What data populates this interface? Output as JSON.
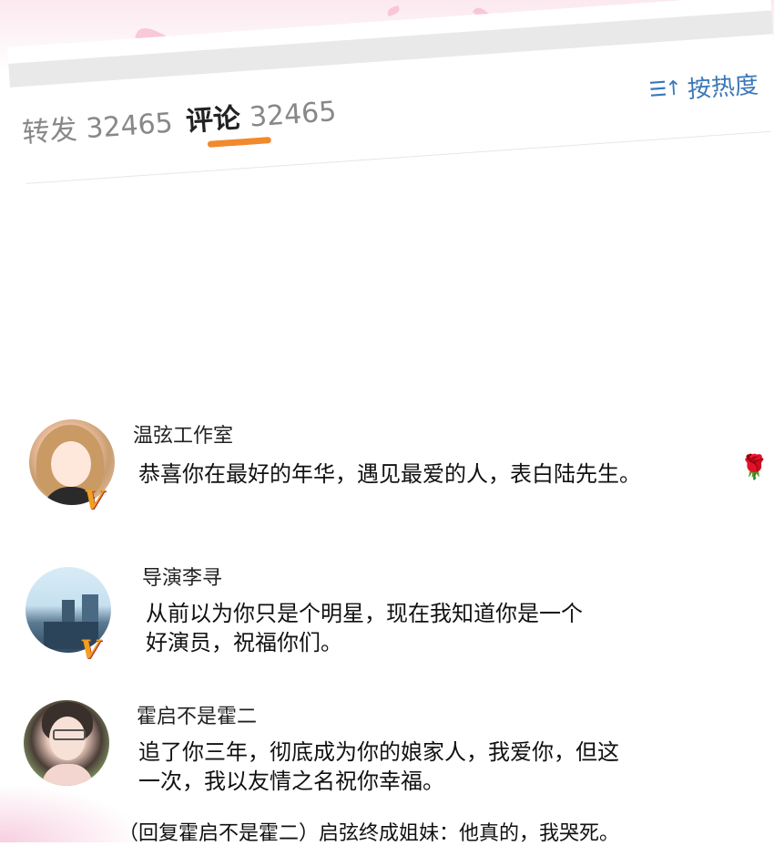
{
  "tabs": {
    "repost_label": "转发",
    "repost_count": "32465",
    "comments_label": "评论",
    "comments_count": "32465",
    "sort_label": "按热度",
    "sort_icon": "sort-descending-icon",
    "active_color": "#f08a2c",
    "sort_color": "#3b78b8"
  },
  "comments": [
    {
      "username": "温弦工作室",
      "text": "恭喜你在最好的年华，遇见最爱的人，表白陆先生。",
      "emoji": "🌹",
      "verified": "V"
    },
    {
      "username": "导演李寻",
      "text_line1": "从前以为你只是个明星，现在我知道你是一个",
      "text_line2": "好演员，祝福你们。",
      "verified": "V"
    },
    {
      "username": "霍启不是霍二",
      "text_line1": "追了你三年，彻底成为你的娘家人，我爱你，但这",
      "text_line2": "一次，我以友情之名祝你幸福。"
    }
  ],
  "reply": "（回复霍启不是霍二）启弦终成姐妹：他真的，我哭死。"
}
